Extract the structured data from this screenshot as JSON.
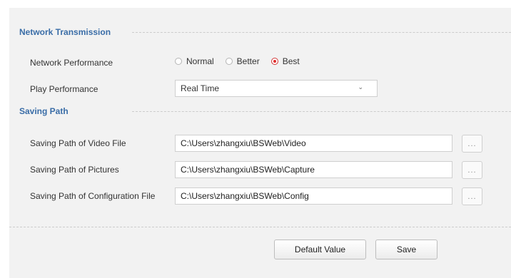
{
  "network_transmission": {
    "title": "Network Transmission",
    "network_performance": {
      "label": "Network Performance",
      "options": [
        "Normal",
        "Better",
        "Best"
      ],
      "selected": "Best"
    },
    "play_performance": {
      "label": "Play Performance",
      "value": "Real Time"
    }
  },
  "saving_path": {
    "title": "Saving Path",
    "video": {
      "label": "Saving Path of Video File",
      "value": "C:\\Users\\zhangxiu\\BSWeb\\Video"
    },
    "pictures": {
      "label": "Saving Path of Pictures",
      "value": "C:\\Users\\zhangxiu\\BSWeb\\Capture"
    },
    "config": {
      "label": "Saving Path of Configuration File",
      "value": "C:\\Users\\zhangxiu\\BSWeb\\Config"
    },
    "browse_label": "..."
  },
  "footer": {
    "default_label": "Default Value",
    "save_label": "Save"
  },
  "colors": {
    "section_title": "#3a6da7",
    "panel_bg": "#f2f2f2",
    "radio_selected": "#e02f2f"
  }
}
